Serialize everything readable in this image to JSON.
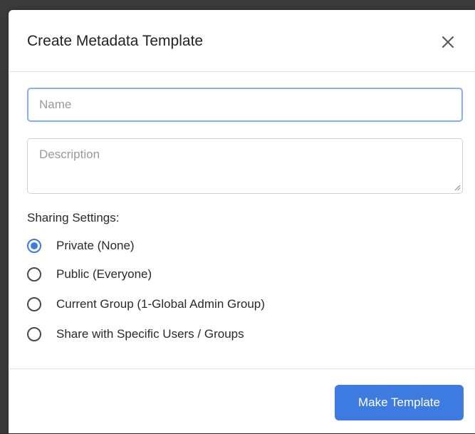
{
  "modal": {
    "title": "Create Metadata Template",
    "close_icon": "close-icon"
  },
  "form": {
    "name_placeholder": "Name",
    "name_value": "",
    "description_placeholder": "Description",
    "description_value": "",
    "sharing_label": "Sharing Settings:",
    "sharing_options": [
      {
        "label": "Private (None)",
        "selected": true
      },
      {
        "label": "Public (Everyone)",
        "selected": false
      },
      {
        "label": "Current Group (1-Global Admin Group)",
        "selected": false
      },
      {
        "label": "Share with Specific Users / Groups",
        "selected": false
      }
    ]
  },
  "footer": {
    "submit_label": "Make Template"
  },
  "colors": {
    "primary": "#3d7be0",
    "focus_border": "#86aef0",
    "text": "#222222",
    "placeholder": "#9a9a9a"
  }
}
